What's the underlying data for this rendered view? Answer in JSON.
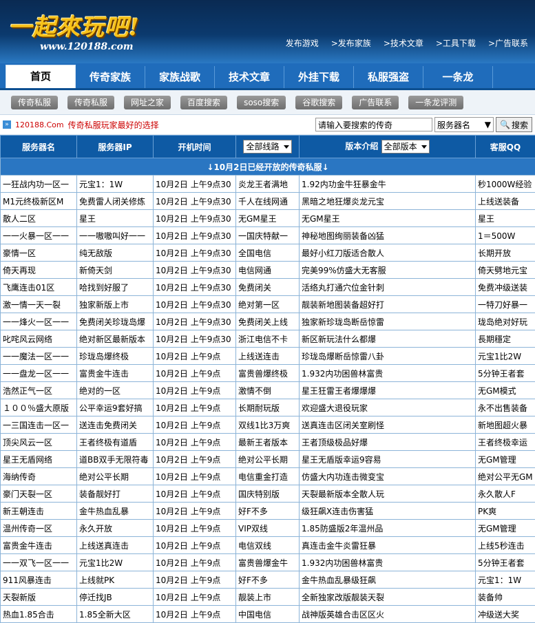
{
  "header": {
    "logo_text": "一起來玩吧!",
    "logo_url": "www.120188.com",
    "links": [
      "发布游戏",
      ">发布家族",
      ">技术文章",
      ">工具下载",
      ">广告联系"
    ]
  },
  "nav": [
    "首页",
    "传奇家族",
    "家族战歌",
    "技术文章",
    "外挂下载",
    "私服强盗",
    "一条龙"
  ],
  "subnav": [
    "传奇私服",
    "传奇私服",
    "网址之家",
    "百度搜索",
    "soso搜索",
    "谷歌搜索",
    "广告联系",
    "一条龙评测"
  ],
  "promo": {
    "site": "120188.Com",
    "text": "传奇私服玩家最好的选择"
  },
  "search": {
    "placeholder": "请输入要搜索的传奇",
    "select": "服务器名",
    "button": "搜索"
  },
  "table": {
    "headers": {
      "name": "服务器名",
      "ip": "服务器IP",
      "time": "开机时间",
      "route_select": "全部线路",
      "version_label": "版本介绍",
      "version_select": "全部版本",
      "qq": "客服QQ"
    },
    "date_banner": "↓10月2日已经开放的传奇私服↓",
    "rows": [
      [
        "一狂战内功一区一",
        "元宝1：1W",
        "10月2日 上午9点30",
        "炎龙王者满地",
        "1.92内功金牛狂暴金牛",
        "秒1000W经验"
      ],
      [
        "M1元终极新区M",
        "免费雷人闭关修炼",
        "10月2日 上午9点30",
        "千人在线网通",
        "黑暗之地狂爆炎龙元宝",
        "上线送装备"
      ],
      [
        "散人二区",
        "星王",
        "10月2日 上午9点30",
        "无GM星王",
        "无GM星王",
        "星王"
      ],
      [
        "一一火暴一区一一",
        "一一嗷嗷叫好一一",
        "10月2日 上午9点30",
        "一国庆特献一",
        "神秘地图绚丽装备凶猛",
        "1＝500W"
      ],
      [
        "豪情一区",
        "纯无敌版",
        "10月2日 上午9点30",
        "全国电信",
        "最好小红刀版适合散人",
        "长期开放"
      ],
      [
        "倚天再现",
        "新倚天剑",
        "10月2日 上午9点30",
        "电信网通",
        "完美99%仿盛大无客服",
        "倚天劈地元宝"
      ],
      [
        "飞鹰连击01区",
        "哈找到好服了",
        "10月2日 上午9点30",
        "免费闭关",
        "活络丸打通穴位金针刺",
        "免费冲级送装"
      ],
      [
        "激一情一天一裂",
        "独家新版上市",
        "10月2日 上午9点30",
        "绝对第一区",
        "靓装新地图装备超好打",
        "一特刀好暴一"
      ],
      [
        "一一烽火一区一一",
        "免费闭关珍珑岛爆",
        "10月2日 上午9点30",
        "免费闭关上线",
        "独家新珍珑岛断岳惊雷",
        "珑岛绝对好玩"
      ],
      [
        "叱咤风云网络",
        "绝对新区最新版本",
        "10月2日 上午9点30",
        "浙江电信不卡",
        "新区新玩法什么都爆",
        "長期穩定"
      ],
      [
        "一一魔法一区一一",
        "珍珑岛爆终极",
        "10月2日 上午9点",
        "上线送连击",
        "珍珑岛爆断岳惊雷八卦",
        "元宝1比2W"
      ],
      [
        "一一盘龙一区一一",
        "富贵金牛连击",
        "10月2日 上午9点",
        "富贵兽爆终极",
        "1.932内功困兽林富贵",
        "5分钟王者套"
      ],
      [
        "浩然正气一区",
        "绝对的一区",
        "10月2日 上午9点",
        "激情不倒",
        "星王狂雷王者爆爆爆",
        "无GM模式"
      ],
      [
        "１００％盛大原版",
        "公平幸运9套好搞",
        "10月2日 上午9点",
        "长期耐玩版",
        "欢迎盛大退役玩家",
        "永不出售装备"
      ],
      [
        "一三国连击一区一",
        "送连击免费闭关",
        "10月2日 上午9点",
        "双线1比3万爽",
        "送真连击区闭关室刷怪",
        "新地图超火暴"
      ],
      [
        "顶尖风云一区",
        "王者终极有道盾",
        "10月2日 上午9点",
        "最新王者版本",
        "王者顶级极品好爆",
        "王者终极幸运"
      ],
      [
        "星王无盾网络",
        "道BB双手无限符毒",
        "10月2日 上午9点",
        "绝对公平长期",
        "星王无盾版幸运9容易",
        "无GM管理"
      ],
      [
        "海纳传奇",
        "绝对公平长期",
        "10月2日 上午9点",
        "电信重金打造",
        "仿盛大内功连击微变宝",
        "绝对公平无GM"
      ],
      [
        "豪门天裂一区",
        "装备靓好打",
        "10月2日 上午9点",
        "国庆特别版",
        "天裂最新版本全散人玩",
        "永久散人F"
      ],
      [
        "新王朝连击",
        "金牛热血乱暴",
        "10月2日 上午9点",
        "好F不多",
        "级狂飙X连击伤害猛",
        "PK爽"
      ],
      [
        "温州传奇一区",
        "永久开放",
        "10月2日 上午9点",
        "VIP双线",
        "1.85防盛版2年温州品",
        "无GM管理"
      ],
      [
        "富贵金牛连击",
        "上线送真连击",
        "10月2日 上午9点",
        "电信双线",
        "真连击金牛炎雷狂暴",
        "上线5秒连击"
      ],
      [
        "一一双飞一区一一",
        "元宝1比2W",
        "10月2日 上午9点",
        "富贵兽爆金牛",
        "1.932内功困兽林富贵",
        "5分钟王者套"
      ],
      [
        "911风暴连击",
        "上线就PK",
        "10月2日 上午9点",
        "好F不多",
        "金牛热血乱暴级狂飙",
        "元宝1：1W"
      ],
      [
        "天裂新版",
        "停迁找JB",
        "10月2日 上午9点",
        "靓装上市",
        "全新独家改版靓装天裂",
        "装备帅"
      ],
      [
        "热血1.85合击",
        "1.85全新大区",
        "10月2日 上午9点",
        "中国电信",
        "战神版英雄合击区区火",
        "冲级送大奖"
      ]
    ]
  }
}
